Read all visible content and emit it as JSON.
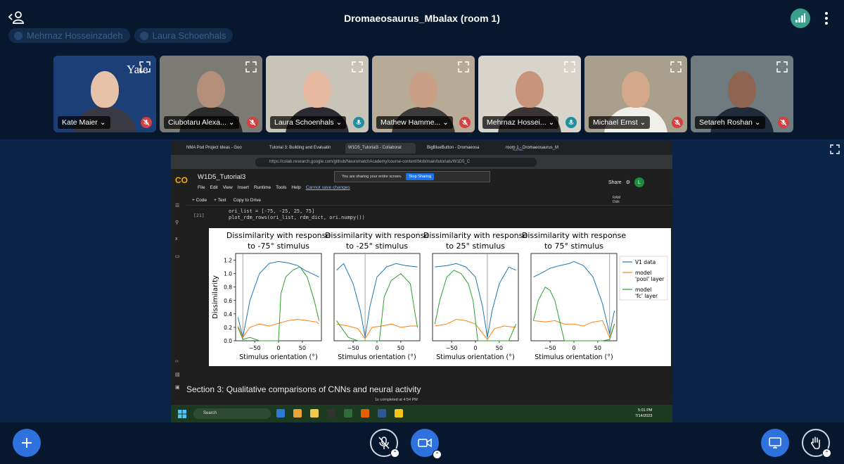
{
  "header": {
    "room_title": "Dromaeosaurus_Mbalax (room 1)",
    "talkers": [
      "Mehrnaz Hosseinzadeh",
      "Laura Schoenhals"
    ]
  },
  "participants": [
    {
      "name": "Kate Maier",
      "mic": "off",
      "bg": "#1d3f78",
      "skin": "#e6c2a8",
      "shirt": "#3a3a44"
    },
    {
      "name": "Ciubotaru Alexa...",
      "mic": "off",
      "bg": "#7c7a74",
      "skin": "#b4907a",
      "shirt": "#2a2a2a"
    },
    {
      "name": "Laura Schoenhals",
      "mic": "on",
      "bg": "#c9c4b8",
      "skin": "#e6b9a0",
      "shirt": "#2b2a30"
    },
    {
      "name": "Mathew Hamme...",
      "mic": "off",
      "bg": "#b7ab98",
      "skin": "#c99f86",
      "shirt": "#3c3a3a"
    },
    {
      "name": "Mehrnaz Hossei...",
      "mic": "on",
      "bg": "#d8d4cc",
      "skin": "#c7957c",
      "shirt": "#3a3434"
    },
    {
      "name": "Michael Ernst",
      "mic": "off",
      "bg": "#a89f8c",
      "skin": "#d3a88a",
      "shirt": "#f1efe9"
    },
    {
      "name": "Setareh Roshan",
      "mic": "off",
      "bg": "#6f7b7e",
      "skin": "#8e6551",
      "shirt": "#1f2a3a"
    }
  ],
  "kate_logo_text": "Yale",
  "shared_screen": {
    "tabs": [
      "NMA Pod Project Ideas - Goo",
      "Tutorial 3: Building and Evaluatin",
      "W1D5_Tutorial3 - Collaborat",
      "BigBlueButton - Dromaeosa",
      "room 1 - Dromaeosaurus_M"
    ],
    "tab_sub": "PLAYING",
    "url": "https://colab.research.google.com/github/NeuromatchAcademy/course-content/blob/main/tutorials/W1D5_C",
    "notebook_title": "W1D5_Tutorial3",
    "menu": [
      "File",
      "Edit",
      "View",
      "Insert",
      "Runtime",
      "Tools",
      "Help"
    ],
    "menu_warning": "Cannot save changes",
    "share_notice": "You are sharing your entire screen.",
    "stop_sharing": "Stop Sharing",
    "share_label": "Share",
    "user_initial": "L",
    "toolbar": [
      "+ Code",
      "+ Text",
      "Copy to Drive"
    ],
    "ram_label": "RAM",
    "disk_label": "Disk",
    "exec_count": "[21]",
    "code_lines": [
      "ori_list = [-75, -25, 25, 75]",
      "plot_rdm_rows(ori_list, rdm_dict, ori.numpy())"
    ],
    "section_heading": "Section 3: Qualitative comparisons of CNNs and neural activity",
    "status": "1s   completed at 4:54 PM",
    "taskbar_search": "Search",
    "clock_time": "5:01 PM",
    "clock_date": "7/14/2023"
  },
  "chart_data": {
    "type": "line",
    "ylabel": "Dissimilarity",
    "xlabel": "Stimulus orientation (°)",
    "xticks": [
      -50,
      0,
      50
    ],
    "yticks": [
      0.0,
      0.2,
      0.4,
      0.6,
      0.8,
      1.0,
      1.2
    ],
    "ylim": [
      0,
      1.3
    ],
    "xlim": [
      -90,
      90
    ],
    "legend": [
      "V1 data",
      "model\n'pool' layer",
      "model\n'fc' layer"
    ],
    "legend_placement": "right",
    "colors": {
      "v1": "#1f77b4",
      "pool": "#ff7f0e",
      "fc": "#2ca02c"
    },
    "panels": [
      {
        "title_line1": "Dissimilarity with response",
        "title_line2": "to -75° stimulus",
        "stim": -75,
        "v1_x": [
          -85,
          -75,
          -60,
          -40,
          -20,
          0,
          20,
          40,
          55,
          70,
          85
        ],
        "v1": [
          0.35,
          0.05,
          0.6,
          1.0,
          1.15,
          1.18,
          1.16,
          1.12,
          1.05,
          1.0,
          0.95
        ],
        "pool_x": [
          -85,
          -75,
          -60,
          -40,
          -20,
          0,
          20,
          40,
          60,
          80,
          85
        ],
        "pool": [
          0.22,
          0.05,
          0.2,
          0.25,
          0.22,
          0.26,
          0.3,
          0.32,
          0.3,
          0.28,
          0.25
        ],
        "fc_x": [
          -85,
          -75,
          -60,
          -40,
          -20,
          0,
          5,
          15,
          30,
          45,
          60,
          75,
          85
        ],
        "fc": [
          0.2,
          0.02,
          0.05,
          0.0,
          0.0,
          0.0,
          0.7,
          0.95,
          1.05,
          1.1,
          0.95,
          0.6,
          0.3
        ]
      },
      {
        "title_line1": "Dissimilarity with response",
        "title_line2": "to -25° stimulus",
        "stim": -25,
        "v1_x": [
          -85,
          -70,
          -50,
          -35,
          -25,
          -15,
          0,
          20,
          40,
          60,
          85
        ],
        "v1": [
          1.05,
          1.15,
          0.85,
          0.45,
          0.05,
          0.5,
          0.95,
          1.1,
          1.15,
          1.12,
          1.1
        ],
        "pool_x": [
          -85,
          -60,
          -40,
          -25,
          -10,
          10,
          30,
          50,
          70,
          85
        ],
        "pool": [
          0.25,
          0.22,
          0.18,
          0.03,
          0.2,
          0.22,
          0.25,
          0.2,
          0.22,
          0.22
        ],
        "fc_x": [
          -85,
          -60,
          -40,
          -25,
          -10,
          5,
          15,
          30,
          50,
          70,
          80,
          85
        ],
        "fc": [
          0.3,
          0.05,
          0.0,
          0.0,
          0.0,
          0.0,
          0.65,
          0.9,
          1.0,
          0.85,
          0.4,
          0.2
        ]
      },
      {
        "title_line1": "Dissimilarity with response",
        "title_line2": "to  25° stimulus",
        "stim": 25,
        "v1_x": [
          -85,
          -60,
          -40,
          -20,
          0,
          15,
          25,
          35,
          50,
          70,
          85
        ],
        "v1": [
          1.1,
          1.12,
          1.15,
          1.1,
          0.95,
          0.5,
          0.05,
          0.45,
          0.85,
          1.1,
          1.05
        ],
        "pool_x": [
          -85,
          -60,
          -40,
          -20,
          0,
          25,
          40,
          60,
          85
        ],
        "pool": [
          0.22,
          0.25,
          0.32,
          0.3,
          0.25,
          0.02,
          0.18,
          0.22,
          0.2
        ],
        "fc_x": [
          -85,
          -75,
          -60,
          -45,
          -30,
          -15,
          -5,
          5,
          25,
          45,
          70,
          85
        ],
        "fc": [
          0.25,
          0.6,
          0.95,
          1.05,
          1.0,
          0.85,
          0.6,
          0.0,
          0.0,
          0.0,
          0.0,
          0.25
        ]
      },
      {
        "title_line1": "Dissimilarity with response",
        "title_line2": "to  75° stimulus",
        "stim": 75,
        "v1_x": [
          -85,
          -70,
          -50,
          -30,
          -10,
          0,
          20,
          40,
          60,
          75,
          85
        ],
        "v1": [
          0.95,
          1.0,
          1.08,
          1.12,
          1.15,
          1.18,
          1.12,
          0.95,
          0.55,
          0.1,
          0.45
        ],
        "pool_x": [
          -85,
          -60,
          -40,
          -20,
          0,
          20,
          40,
          60,
          75,
          85
        ],
        "pool": [
          0.3,
          0.28,
          0.3,
          0.25,
          0.25,
          0.22,
          0.28,
          0.3,
          0.05,
          0.25
        ],
        "fc_x": [
          -85,
          -75,
          -60,
          -50,
          -40,
          -20,
          0,
          20,
          40,
          60,
          75,
          85
        ],
        "fc": [
          0.3,
          0.6,
          0.8,
          0.75,
          0.6,
          0.0,
          0.0,
          0.0,
          0.0,
          0.0,
          0.02,
          0.25
        ]
      }
    ]
  }
}
